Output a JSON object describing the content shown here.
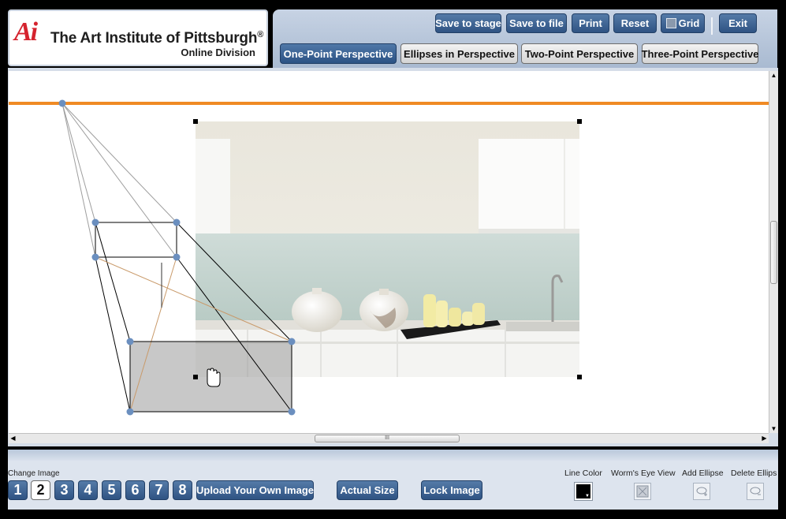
{
  "logo": {
    "mark": "Ai",
    "title": "The Art Institute of Pittsburgh",
    "registered": "®",
    "subtitle": "Online Division"
  },
  "toolbar": {
    "save_stage": "Save to stage",
    "save_file": "Save to file",
    "print": "Print",
    "reset": "Reset",
    "grid": "Grid",
    "exit": "Exit"
  },
  "tabs": [
    {
      "label": "One-Point Perspective",
      "active": true
    },
    {
      "label": "Ellipses in Perspective",
      "active": false
    },
    {
      "label": "Two-Point Perspective",
      "active": false
    },
    {
      "label": "Three-Point Perspective",
      "active": false
    }
  ],
  "canvas": {
    "horizon_color": "#f08a24",
    "vanishing_point_color": "#6b8fbf",
    "image_description": "kitchen photo"
  },
  "bottom": {
    "change_image_label": "Change Image",
    "image_numbers": [
      "1",
      "2",
      "3",
      "4",
      "5",
      "6",
      "7",
      "8"
    ],
    "selected_image": "2",
    "upload": "Upload Your Own Image",
    "actual_size": "Actual Size",
    "lock_image": "Lock Image",
    "line_color_label": "Line Color",
    "line_color": "#000000",
    "worms_eye_label": "Worm's Eye View",
    "add_ellipse_label": "Add Ellipse",
    "delete_ellipse_label": "Delete Ellips"
  },
  "colors": {
    "button_blue": "#2f5383",
    "panel": "#dde4ee"
  }
}
